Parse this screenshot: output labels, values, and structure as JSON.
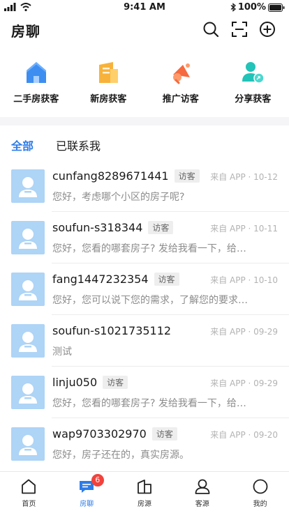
{
  "status_bar": {
    "time": "9:41 AM",
    "battery": "100%"
  },
  "nav": {
    "title": "房聊",
    "icons": [
      "search-icon",
      "scan-icon",
      "add-circle-icon"
    ]
  },
  "quick_actions": [
    {
      "label": "二手房获客",
      "icon": "house-icon",
      "color": "#3d8ef0"
    },
    {
      "label": "新房获客",
      "icon": "building-icon",
      "color": "#f7b23b"
    },
    {
      "label": "推广访客",
      "icon": "megaphone-icon",
      "color": "#f56a3e"
    },
    {
      "label": "分享获客",
      "icon": "user-share-icon",
      "color": "#22c3b8"
    }
  ],
  "tabs": [
    {
      "label": "全部",
      "active": true
    },
    {
      "label": "已联系我",
      "active": false
    }
  ],
  "conversations": [
    {
      "name": "cunfang8289671441",
      "badge": "访客",
      "meta": "来自 APP · 10-12",
      "preview": "您好，考虑哪个小区的房子呢?"
    },
    {
      "name": "soufun-s318344",
      "badge": "访客",
      "meta": "来自 APP · 10-11",
      "preview": "您好，您看的哪套房子? 发给我看一下，给…"
    },
    {
      "name": "fang1447232354",
      "badge": "访客",
      "meta": "来自 APP · 10-10",
      "preview": "您好，您可以说下您的需求，了解您的要求…"
    },
    {
      "name": "soufun-s1021735112",
      "badge": "",
      "meta": "来自 APP · 09-29",
      "preview": "测试"
    },
    {
      "name": "linju050",
      "badge": "访客",
      "meta": "来自 APP · 09-29",
      "preview": "您好，您看的哪套房子? 发给我看一下，给…"
    },
    {
      "name": "wap9703302970",
      "badge": "访客",
      "meta": "来自 APP · 09-20",
      "preview": "您好，房子还在的，真实房源。"
    }
  ],
  "tab_bar": [
    {
      "label": "首页",
      "icon": "home-icon",
      "active": false,
      "badge": ""
    },
    {
      "label": "房聊",
      "icon": "chat-icon",
      "active": true,
      "badge": "6"
    },
    {
      "label": "房源",
      "icon": "buildings-icon",
      "active": false,
      "badge": ""
    },
    {
      "label": "客源",
      "icon": "person-icon",
      "active": false,
      "badge": ""
    },
    {
      "label": "我的",
      "icon": "profile-circle-icon",
      "active": false,
      "badge": ""
    }
  ],
  "colors": {
    "accent": "#2d7ce8",
    "badge_red": "#f2423c",
    "avatar_bg": "#aed4f6"
  }
}
